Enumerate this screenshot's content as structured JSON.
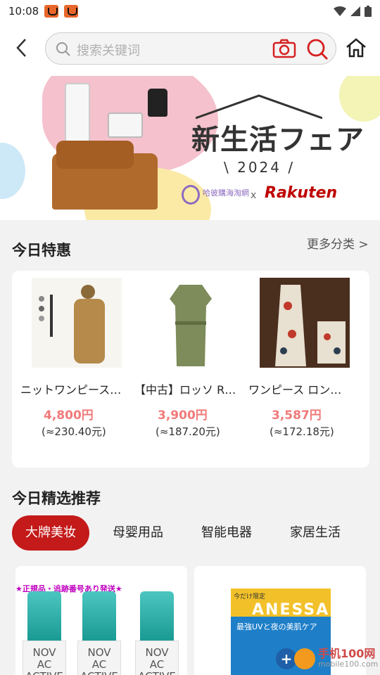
{
  "status_bar": {
    "time": "10:08"
  },
  "search": {
    "placeholder": "搜索关键词"
  },
  "banner": {
    "title": "新生活フェア",
    "year": "\\ 2024 /",
    "partner": "哈彼購海淘網",
    "separator": "x",
    "brand": "Rakuten"
  },
  "deals": {
    "title": "今日特惠",
    "more": "更多分类 >",
    "items": [
      {
        "name": "ニットワンピース…",
        "price": "4,800円",
        "converted": "(≈230.40元)"
      },
      {
        "name": "【中古】ロッソ R…",
        "price": "3,900円",
        "converted": "(≈187.20元)"
      },
      {
        "name": "ワンピース ロン…",
        "price": "3,587円",
        "converted": "(≈172.18元)"
      }
    ]
  },
  "recommend": {
    "title": "今日精选推荐",
    "tabs": [
      "大牌美妆",
      "母婴用品",
      "智能电器",
      "家居生活"
    ],
    "active_tab": 0,
    "card1": {
      "promo": "★正規品・追跡番号あり発送★",
      "product_text": "NOV\nAC\nACTIVE"
    },
    "card2": {
      "tag": "今だけ限定",
      "brand": "ANESSA",
      "line": "最強UVと夜の美肌ケア"
    }
  },
  "watermark": {
    "site": "手机100网",
    "url": "mobile100.com"
  },
  "colors": {
    "accent": "#c41a1a",
    "price": "#f07a7a",
    "rakuten": "#bf0000"
  }
}
